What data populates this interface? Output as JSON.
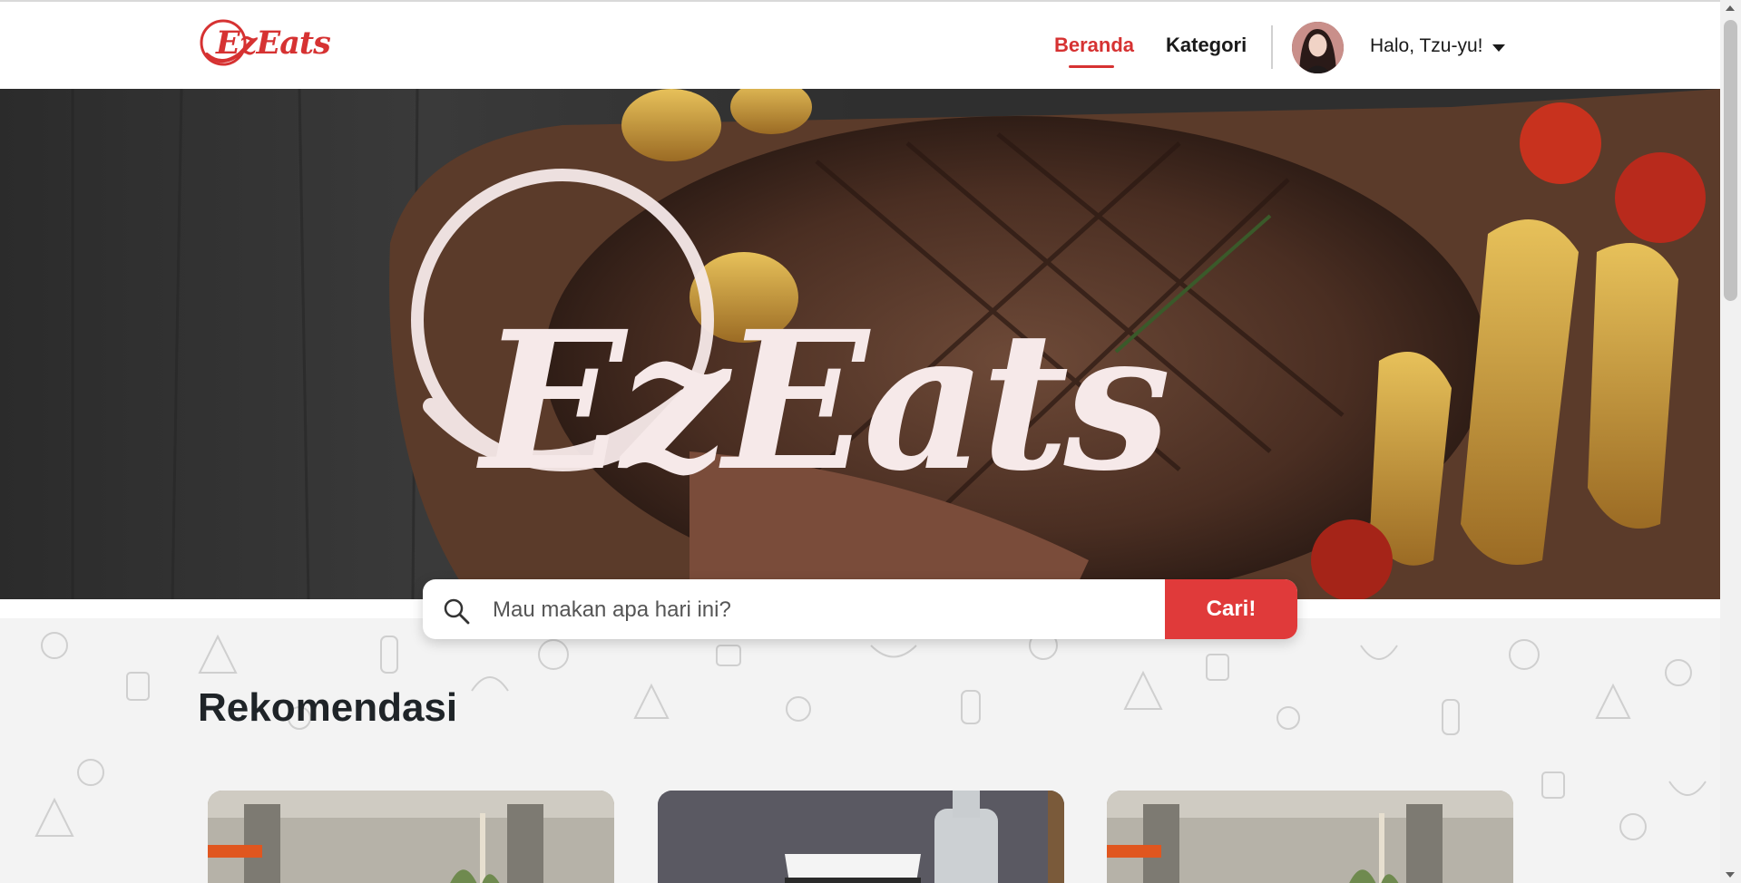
{
  "brand": {
    "name": "EzEats",
    "accent_color": "#d63232",
    "button_color": "#e03a3a"
  },
  "navbar": {
    "links": [
      {
        "label": "Beranda",
        "active": true
      },
      {
        "label": "Kategori",
        "active": false
      }
    ],
    "user": {
      "greeting": "Halo, Tzu-yu!",
      "avatar_icon": "user-avatar",
      "menu_icon": "caret-down-icon"
    }
  },
  "hero": {
    "logo_text": "EzEats",
    "image": "grilled-steak-with-potato-wedges"
  },
  "search": {
    "placeholder": "Mau makan apa hari ini?",
    "value": "",
    "button_label": "Cari!",
    "icon": "search-icon"
  },
  "recommendations": {
    "title": "Rekomendasi",
    "cards": [
      {
        "image": "restaurant-interior-photo"
      },
      {
        "image": "drink-cup-photo"
      },
      {
        "image": "restaurant-interior-photo"
      }
    ]
  }
}
